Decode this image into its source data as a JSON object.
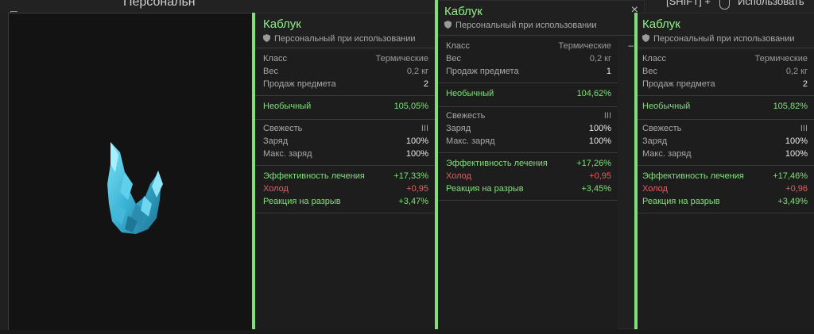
{
  "top": {
    "partial_title": "Персональн",
    "shift_hint": "[SHIFT] +",
    "use_hint": "Использовать"
  },
  "colors": {
    "rarity": "#7fe07a",
    "negative": "#e06060"
  },
  "tooltips": [
    {
      "name": "Каблук",
      "bind": "Персональный при использовании",
      "close": "×",
      "collapse": "–",
      "base": [
        {
          "k": "Класс",
          "v": "Термические"
        },
        {
          "k": "Вес",
          "v": "0,2 кг"
        },
        {
          "k": "Продаж предмета",
          "v": "2"
        }
      ],
      "rarity": {
        "k": "Необычный",
        "v": "105,05%"
      },
      "charge": [
        {
          "k": "Свежесть",
          "v": "III"
        },
        {
          "k": "Заряд",
          "v": "100%"
        },
        {
          "k": "Макс. заряд",
          "v": "100%"
        }
      ],
      "stats": [
        {
          "k": "Эффективность лечения",
          "v": "+17,33%",
          "c": "green"
        },
        {
          "k": "Холод",
          "v": "+0,95",
          "c": "red"
        },
        {
          "k": "Реакция на разрыв",
          "v": "+3,47%",
          "c": "green"
        }
      ]
    },
    {
      "name": "Каблук",
      "bind": "Персональный при использовании",
      "close": "×",
      "collapse": "–",
      "base": [
        {
          "k": "Класс",
          "v": "Термические"
        },
        {
          "k": "Вес",
          "v": "0,2 кг"
        },
        {
          "k": "Продаж предмета",
          "v": "1"
        }
      ],
      "rarity": {
        "k": "Необычный",
        "v": "104,62%"
      },
      "charge": [
        {
          "k": "Свежесть",
          "v": "III"
        },
        {
          "k": "Заряд",
          "v": "100%"
        },
        {
          "k": "Макс. заряд",
          "v": "100%"
        }
      ],
      "stats": [
        {
          "k": "Эффективность лечения",
          "v": "+17,26%",
          "c": "green"
        },
        {
          "k": "Холод",
          "v": "+0,95",
          "c": "red"
        },
        {
          "k": "Реакция на разрыв",
          "v": "+3,45%",
          "c": "green"
        }
      ]
    },
    {
      "name": "Каблук",
      "bind": "Персональный при использовании",
      "close": "×",
      "collapse": "–",
      "base": [
        {
          "k": "Класс",
          "v": "Термические"
        },
        {
          "k": "Вес",
          "v": "0,2 кг"
        },
        {
          "k": "Продаж предмета",
          "v": "2"
        }
      ],
      "rarity": {
        "k": "Необычный",
        "v": "105,82%"
      },
      "charge": [
        {
          "k": "Свежесть",
          "v": "III"
        },
        {
          "k": "Заряд",
          "v": "100%"
        },
        {
          "k": "Макс. заряд",
          "v": "100%"
        }
      ],
      "stats": [
        {
          "k": "Эффективность лечения",
          "v": "+17,46%",
          "c": "green"
        },
        {
          "k": "Холод",
          "v": "+0,96",
          "c": "red"
        },
        {
          "k": "Реакция на разрыв",
          "v": "+3,49%",
          "c": "green"
        }
      ]
    }
  ]
}
